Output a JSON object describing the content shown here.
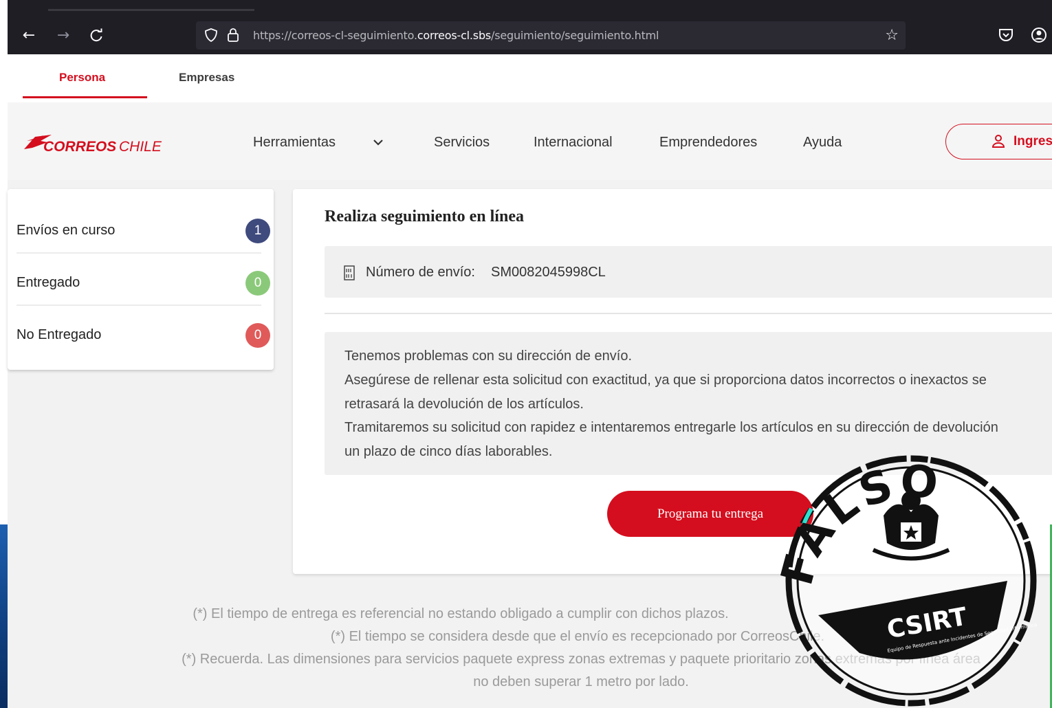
{
  "browser": {
    "url_prefix": "https://correos-cl-seguimiento.",
    "url_domain": "correos-cl.sbs",
    "url_path": "/seguimiento/seguimiento.html",
    "back_icon": "←",
    "forward_icon": "→",
    "reload_icon": "C",
    "star_icon": "☆"
  },
  "top_tabs": [
    {
      "label": "Persona"
    },
    {
      "label": "Empresas"
    }
  ],
  "header": {
    "logo_text_bold": "CORREOS",
    "logo_text_light": "CHILE",
    "menu": [
      {
        "label": "Herramientas"
      },
      {
        "label": "Servicios"
      },
      {
        "label": "Internacional"
      },
      {
        "label": "Emprendedores"
      },
      {
        "label": "Ayuda"
      }
    ],
    "login_label": "Ingres"
  },
  "sidebar": {
    "items": [
      {
        "label": "Envíos en curso",
        "count": "1",
        "color": "#3f4a7d"
      },
      {
        "label": "Entregado",
        "count": "0",
        "color": "#8bc97a"
      },
      {
        "label": "No Entregado",
        "count": "0",
        "color": "#e05a5a"
      }
    ]
  },
  "main": {
    "title": "Realiza seguimiento en línea",
    "tracking_label": "Número de envío:",
    "tracking_number": "SM0082045998CL",
    "message_lines": [
      "Tenemos problemas con su dirección de envío.",
      "Asegúrese de rellenar esta solicitud con exactitud, ya que si proporciona datos incorrectos o inexactos se",
      "retrasará la devolución de los artículos.",
      "Tramitaremos su solicitud con rapidez e intentaremos entregarle los artículos en su dirección de devolución",
      "un plazo de cinco días laborables."
    ],
    "cta_label": "Programa tu entrega"
  },
  "footer": {
    "lines": [
      "(*) El tiempo de entrega es referencial no estando obligado a cumplir con dichos plazos.",
      "(*) El tiempo se considera desde que el envío es recepcionado por CorreosChile.",
      "(*) Recuerda. Las dimensiones para servicios paquete express zonas extremas y paquete prioritario zonas extremas  por línea área",
      "no deben superar 1 metro por lado."
    ]
  },
  "stamp": {
    "word": "FALSO",
    "org": "CSIRT",
    "small_text": "Equipo de Respuesta ante Incidentes de Seguridad Informática"
  },
  "colors": {
    "brand_red": "#d40e1e",
    "browser_bg": "#1f1e25"
  }
}
